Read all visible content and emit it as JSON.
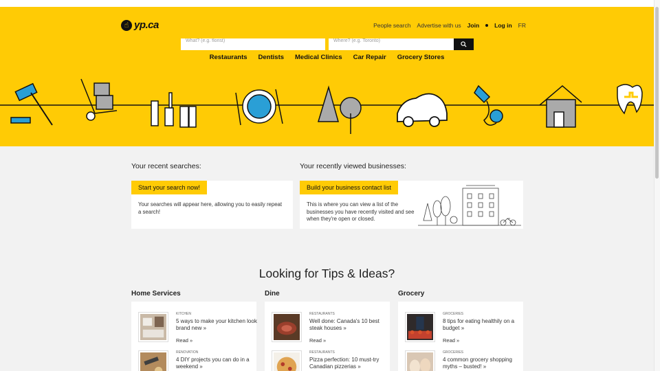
{
  "brand": {
    "logo_text": "yp.ca",
    "accent": "#ffcb05"
  },
  "topnav": {
    "people_search": "People search",
    "advertise": "Advertise with us",
    "join": "Join",
    "login": "Log in",
    "lang": "FR"
  },
  "search": {
    "what_placeholder": "What? (e.g. florist)",
    "where_placeholder": "Where? (e.g. Toronto)",
    "button_icon": "search-icon"
  },
  "categories": [
    "Restaurants",
    "Dentists",
    "Medical Clinics",
    "Car Repair",
    "Grocery Stores"
  ],
  "recent": {
    "searches_title": "Your recent searches:",
    "searches_tag": "Start your search now!",
    "searches_body": "Your searches will appear here, allowing you to easily repeat a search!",
    "viewed_title": "Your recently viewed businesses:",
    "viewed_tag": "Build your business contact list",
    "viewed_body": "This is where you can view a list of the businesses you have recently visited and see when they're open or closed."
  },
  "tips": {
    "title": "Looking for Tips & Ideas?",
    "columns": [
      {
        "title": "Home Services",
        "articles": [
          {
            "category": "KITCHEN",
            "title": "5 ways to make your kitchen look brand new »",
            "read": "Read »"
          },
          {
            "category": "RENOVATION",
            "title": "4 DIY projects you can do in a weekend »",
            "read": ""
          }
        ]
      },
      {
        "title": "Dine",
        "articles": [
          {
            "category": "RESTAURANTS",
            "title": "Well done: Canada's 10 best steak houses »",
            "read": "Read »"
          },
          {
            "category": "RESTAURANTS",
            "title": "Pizza perfection: 10 must-try Canadian pizzerias »",
            "read": ""
          }
        ]
      },
      {
        "title": "Grocery",
        "articles": [
          {
            "category": "GROCERIES",
            "title": "8 tips for eating healthily on a budget »",
            "read": "Read »"
          },
          {
            "category": "GROCERIES",
            "title": "4 common grocery shopping myths – busted! »",
            "read": ""
          }
        ]
      }
    ]
  }
}
